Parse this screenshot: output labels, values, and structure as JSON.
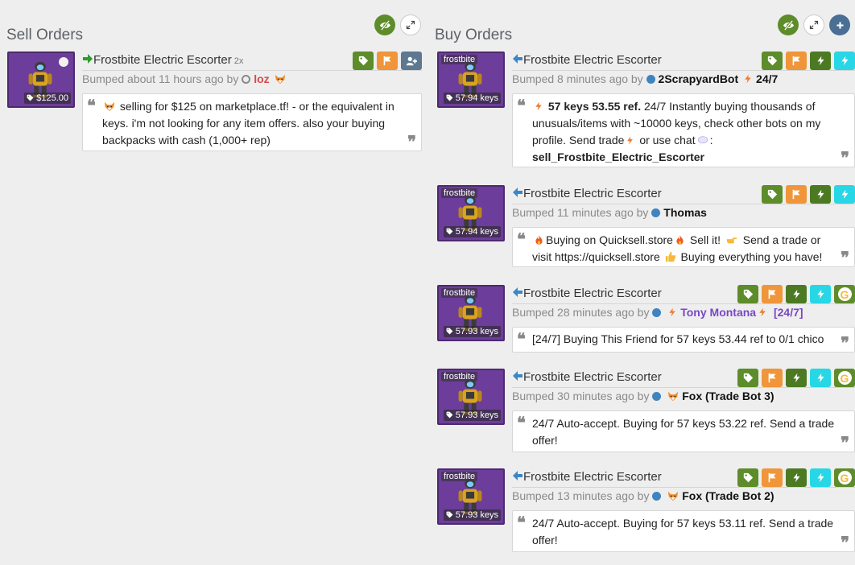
{
  "sell": {
    "title": "Sell Orders",
    "listings": [
      {
        "item_name": "Frostbite Electric Escorter",
        "quantity": "2x",
        "price": "$125.00",
        "bumped": "Bumped about 11 hours ago by",
        "user": "loz",
        "description": "selling for $125 on marketplace.tf! - or the equivalent in keys. i'm not looking for any item offers. also your buying backpacks with cash (1,000+ rep)"
      }
    ]
  },
  "buy": {
    "title": "Buy Orders",
    "listings": [
      {
        "quality": "frostbite",
        "item_name": "Frostbite Electric Escorter",
        "price": "57.94 keys",
        "bumped": "Bumped 8 minutes ago by",
        "user": "2ScrapyardBot",
        "user_suffix": "24/7",
        "desc_bold": "57 keys 53.55 ref.",
        "desc_main": "24/7 Instantly buying thousands of unusuals/items with ~10000 keys, check other bots on my profile. Send",
        "desc_trade": "trade",
        "desc_or": "or",
        "desc_use": "use",
        "desc_chat": "chat",
        "desc_command": "sell_Frostbite_Electric_Escorter"
      },
      {
        "quality": "frostbite",
        "item_name": "Frostbite Electric Escorter",
        "price": "57.94 keys",
        "bumped": "Bumped 11 minutes ago by",
        "user": "Thomas",
        "desc_a": "Buying on Quicksell.store",
        "desc_b": "Sell it!",
        "desc_c": "Send a trade or visit https://quicksell.store",
        "desc_d": "Buying everything you have!"
      },
      {
        "quality": "frostbite",
        "item_name": "Frostbite Electric Escorter",
        "price": "57.93 keys",
        "bumped": "Bumped 28 minutes ago by",
        "user": "Tony Montana",
        "user_suffix": "[24/7]",
        "description": "[24/7] Buying This Friend for 57 keys 53.44 ref to 0/1 chico"
      },
      {
        "quality": "frostbite",
        "item_name": "Frostbite Electric Escorter",
        "price": "57.93 keys",
        "bumped": "Bumped 30 minutes ago by",
        "user": "Fox (Trade Bot 3)",
        "description": "24/7 Auto-accept. Buying for 57 keys 53.22 ref. Send a trade offer!"
      },
      {
        "quality": "frostbite",
        "item_name": "Frostbite Electric Escorter",
        "price": "57.93 keys",
        "bumped": "Bumped 13 minutes ago by",
        "user": "Fox (Trade Bot 2)",
        "description": "24/7 Auto-accept. Buying for 57 keys 53.11 ref. Send a trade offer!"
      }
    ]
  },
  "colors": {
    "background": "#eeeeee",
    "badge_green": "#5d8c2a",
    "badge_orange": "#f0953a",
    "badge_cyan": "#27d7e6",
    "unusual_purple": "#6c3d9a",
    "sell_arrow": "#2f9a2f",
    "buy_arrow": "#3a87c8"
  },
  "icons": [
    "eye-slash-icon",
    "expand-icon",
    "plus-icon",
    "tag-icon",
    "flag-icon",
    "add-friend-icon",
    "lightning-icon",
    "quote-open-icon",
    "quote-close-icon",
    "fox-icon",
    "fire-icon",
    "pointing-hand-icon",
    "thumbs-up-icon",
    "chat-bubble-icon",
    "arrow-right-icon",
    "arrow-left-icon"
  ]
}
